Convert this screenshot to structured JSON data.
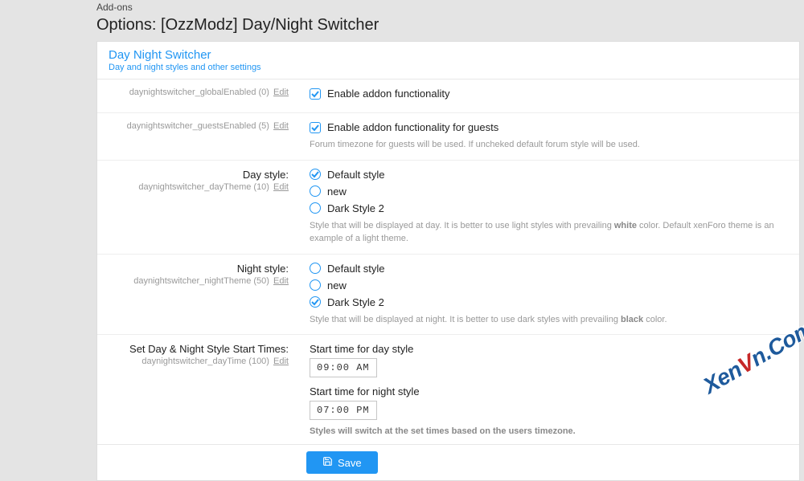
{
  "breadcrumb": "Add-ons",
  "title": "Options: [OzzModz] Day/Night Switcher",
  "section": {
    "title": "Day Night Switcher",
    "subtitle": "Day and night styles and other settings"
  },
  "rows": {
    "global": {
      "meta": "daynightswitcher_globalEnabled (0)",
      "edit": "Edit",
      "label": "Enable addon functionality"
    },
    "guests": {
      "meta": "daynightswitcher_guestsEnabled (5)",
      "edit": "Edit",
      "label": "Enable addon functionality for guests",
      "hint": "Forum timezone for guests will be used. If uncheked default forum style will be used."
    },
    "day": {
      "title": "Day style:",
      "meta": "daynightswitcher_dayTheme (10)",
      "edit": "Edit",
      "options": [
        "Default style",
        "new",
        "Dark Style 2"
      ],
      "hint_pre": "Style that will be displayed at day. It is better to use light styles with prevailing ",
      "hint_bold": "white",
      "hint_post": " color. Default xenForo theme is an example of a light theme."
    },
    "night": {
      "title": "Night style:",
      "meta": "daynightswitcher_nightTheme (50)",
      "edit": "Edit",
      "options": [
        "Default style",
        "new",
        "Dark Style 2"
      ],
      "hint_pre": "Style that will be displayed at night. It is better to use dark styles with prevailing ",
      "hint_bold": "black",
      "hint_post": " color."
    },
    "times": {
      "title": "Set Day & Night Style Start Times:",
      "meta": "daynightswitcher_dayTime (100)",
      "edit": "Edit",
      "day_label": "Start time for day style",
      "day_value": "09:00 AM",
      "night_label": "Start time for night style",
      "night_value": "07:00 PM",
      "hint": "Styles will switch at the set times based on the users timezone."
    }
  },
  "save": "Save",
  "watermark": "XenVn.Com"
}
